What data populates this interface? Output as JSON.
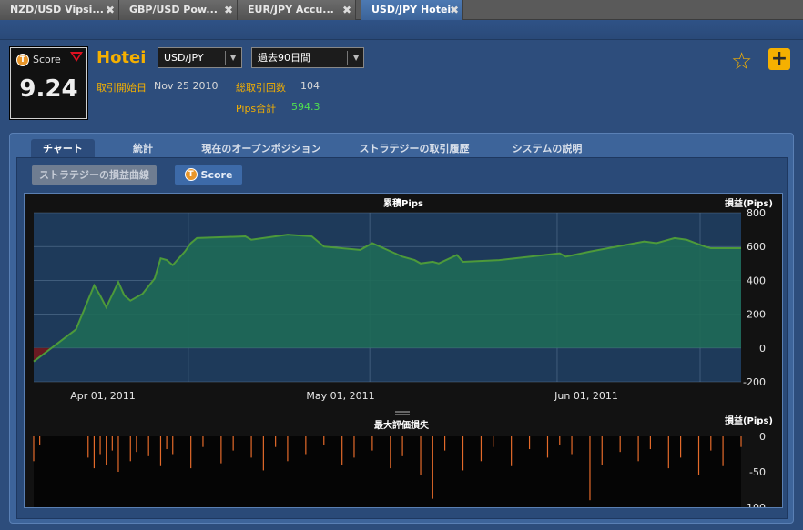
{
  "browser_tabs": [
    {
      "label": "NZD/USD Vipsi...",
      "active": false
    },
    {
      "label": "GBP/USD Pow...",
      "active": false
    },
    {
      "label": "EUR/JPY Accu...",
      "active": false
    },
    {
      "label": "USD/JPY Hotei",
      "active": true
    }
  ],
  "tab_close_glyph": "✖",
  "header": {
    "score_label": "Score",
    "score_value": "9.24",
    "score_icon_letter": "T",
    "strategy_name": "Hotei",
    "pair_select": "USD/JPY",
    "period_select": "過去90日間",
    "start_label": "取引開始日",
    "start_value": "Nov 25 2010",
    "trades_label": "総取引回数",
    "trades_value": "104",
    "pips_label": "Pips合計",
    "pips_value": "594.3",
    "star_icon": "☆",
    "plus_icon": "+"
  },
  "panel_tabs": [
    {
      "label": "チャート",
      "active": true
    },
    {
      "label": "統計",
      "active": false
    },
    {
      "label": "現在のオープンポジション",
      "active": false
    },
    {
      "label": "ストラテジーの取引履歴",
      "active": false
    },
    {
      "label": "システムの説明",
      "active": false
    }
  ],
  "sub_buttons": {
    "equity_curve": "ストラテジーの損益曲線",
    "score": "Score"
  },
  "colors": {
    "accent": "#f5b000",
    "line": "#4d9a3a",
    "area": "#1e6a56",
    "loss_area": "#6a1a22",
    "bars": "#e46a2a",
    "green_value": "#4fe04f"
  },
  "chart_data": [
    {
      "type": "area",
      "title": "累積Pips",
      "ylabel": "損益(Pips)",
      "ylim": [
        -200,
        800
      ],
      "yticks": [
        "800",
        "600",
        "400",
        "200",
        "0",
        "-200"
      ],
      "xticks": [
        "Apr 01, 2011",
        "May 01, 2011",
        "Jun 01, 2011"
      ],
      "grid": true,
      "x": [
        "2011-03-01",
        "2011-03-08",
        "2011-03-11",
        "2011-03-12",
        "2011-03-13",
        "2011-03-15",
        "2011-03-16",
        "2011-03-17",
        "2011-03-19",
        "2011-03-21",
        "2011-03-22",
        "2011-03-23",
        "2011-03-24",
        "2011-03-26",
        "2011-03-27",
        "2011-03-28",
        "2011-04-05",
        "2011-04-06",
        "2011-04-12",
        "2011-04-16",
        "2011-04-18",
        "2011-04-24",
        "2011-04-26",
        "2011-05-01",
        "2011-05-03",
        "2011-05-04",
        "2011-05-06",
        "2011-05-07",
        "2011-05-10",
        "2011-05-11",
        "2011-05-17",
        "2011-05-27",
        "2011-05-28",
        "2011-06-01",
        "2011-06-10",
        "2011-06-12",
        "2011-06-15",
        "2011-06-17",
        "2011-06-20",
        "2011-06-21",
        "2011-06-26"
      ],
      "values": [
        -80,
        110,
        370,
        310,
        240,
        390,
        310,
        280,
        320,
        410,
        530,
        520,
        490,
        570,
        620,
        650,
        660,
        640,
        670,
        660,
        600,
        580,
        620,
        540,
        520,
        500,
        510,
        500,
        550,
        510,
        520,
        560,
        540,
        570,
        630,
        620,
        650,
        640,
        600,
        590,
        590
      ]
    },
    {
      "type": "bar",
      "title": "最大評価損失",
      "ylabel": "損益(Pips)",
      "ylim": [
        -100,
        0
      ],
      "yticks": [
        "0",
        "-50",
        "-100"
      ],
      "x": [
        "2011-03-01",
        "2011-03-02",
        "2011-03-10",
        "2011-03-11",
        "2011-03-12",
        "2011-03-13",
        "2011-03-14",
        "2011-03-15",
        "2011-03-17",
        "2011-03-18",
        "2011-03-20",
        "2011-03-22",
        "2011-03-23",
        "2011-03-24",
        "2011-03-27",
        "2011-03-29",
        "2011-04-01",
        "2011-04-03",
        "2011-04-06",
        "2011-04-08",
        "2011-04-10",
        "2011-04-12",
        "2011-04-15",
        "2011-04-18",
        "2011-04-21",
        "2011-04-23",
        "2011-04-26",
        "2011-04-29",
        "2011-05-01",
        "2011-05-04",
        "2011-05-06",
        "2011-05-08",
        "2011-05-11",
        "2011-05-14",
        "2011-05-16",
        "2011-05-19",
        "2011-05-22",
        "2011-05-25",
        "2011-05-27",
        "2011-05-29",
        "2011-06-01",
        "2011-06-03",
        "2011-06-06",
        "2011-06-09",
        "2011-06-11",
        "2011-06-14",
        "2011-06-16",
        "2011-06-19",
        "2011-06-21",
        "2011-06-23",
        "2011-06-26"
      ],
      "values": [
        -35,
        -12,
        -30,
        -45,
        -25,
        -40,
        -20,
        -50,
        -35,
        -22,
        -28,
        -42,
        -18,
        -25,
        -45,
        -15,
        -38,
        -20,
        -30,
        -48,
        -15,
        -35,
        -25,
        -12,
        -40,
        -30,
        -20,
        -45,
        -28,
        -55,
        -88,
        -20,
        -48,
        -35,
        -15,
        -42,
        -18,
        -30,
        -12,
        -25,
        -90,
        -40,
        -22,
        -35,
        -18,
        -45,
        -30,
        -55,
        -20,
        -42,
        -15
      ]
    }
  ]
}
